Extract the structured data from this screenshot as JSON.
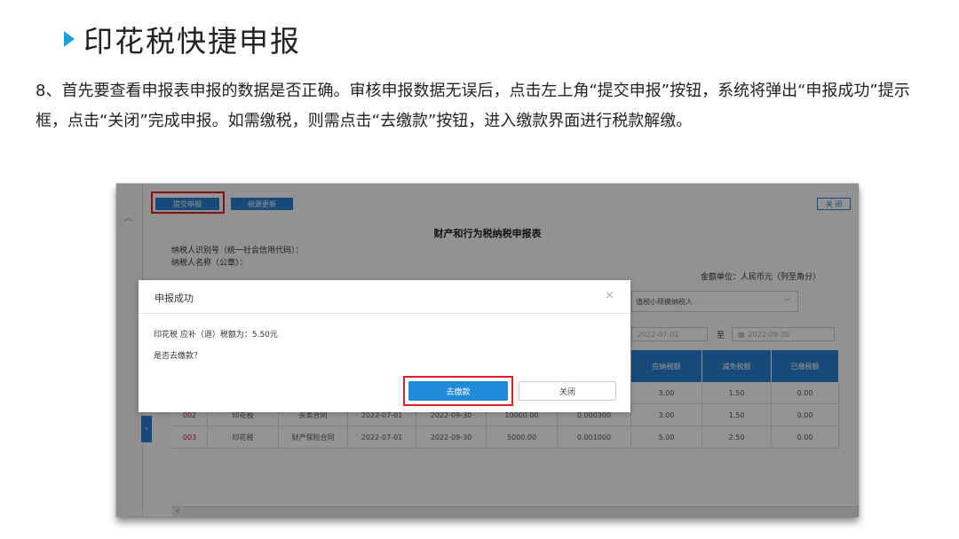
{
  "slide": {
    "title": "印花税快捷申报",
    "instructions": "8、首先要查看申报表申报的数据是否正确。审核申报数据无误后，点击左上角“提交申报”按钮，系统将弹出“申报成功”提示框，点击“关闭”完成申报。如需缴税，则需点击“去缴款”按钮，进入缴款界面进行税款解缴。"
  },
  "colors": {
    "accent": "#1aa3d8",
    "primary_button": "#2a80d0",
    "highlight": "#e21c2a",
    "row_index": "#d0202a"
  },
  "toolbar": {
    "submit_label": "提交申报",
    "refresh_label": "税源更新",
    "close_label": "关 闭"
  },
  "form": {
    "title": "财产和行为税纳税申报表",
    "taxpayer_id_label": "纳税人识别号（统一社会信用代码）：",
    "taxpayer_name_label": "纳税人名称（公章）：",
    "unit_label": "金额单位：人民币元（列至角分）",
    "taxpayer_type": "值税小规模纳税人",
    "period_start": "2022-07-01",
    "period_sep": "至",
    "period_end": "2022-09-30"
  },
  "table": {
    "headers": [
      "应纳税额",
      "减免税额",
      "已缴税额"
    ],
    "rows": [
      {
        "col_j": "3.00",
        "col_k": "1.50",
        "col_l": "0.00"
      },
      {
        "idx": "002",
        "tax": "印花税",
        "item": "买卖合同",
        "start": "2022-07-01",
        "end": "2022-09-30",
        "base": "10000.00",
        "rate": "0.000300",
        "col_j": "3.00",
        "col_k": "1.50",
        "col_l": "0.00"
      },
      {
        "idx": "003",
        "tax": "印花税",
        "item": "财产保险合同",
        "start": "2022-07-01",
        "end": "2022-09-30",
        "base": "5000.00",
        "rate": "0.001000",
        "col_j": "5.00",
        "col_k": "2.50",
        "col_l": "0.00"
      }
    ]
  },
  "dialog": {
    "title": "申报成功",
    "close_icon": "×",
    "message_amount": "印花税 应补（退）税额为：5.50元",
    "message_question": "是否去缴款？",
    "pay_label": "去缴款",
    "close_label": "关闭"
  }
}
